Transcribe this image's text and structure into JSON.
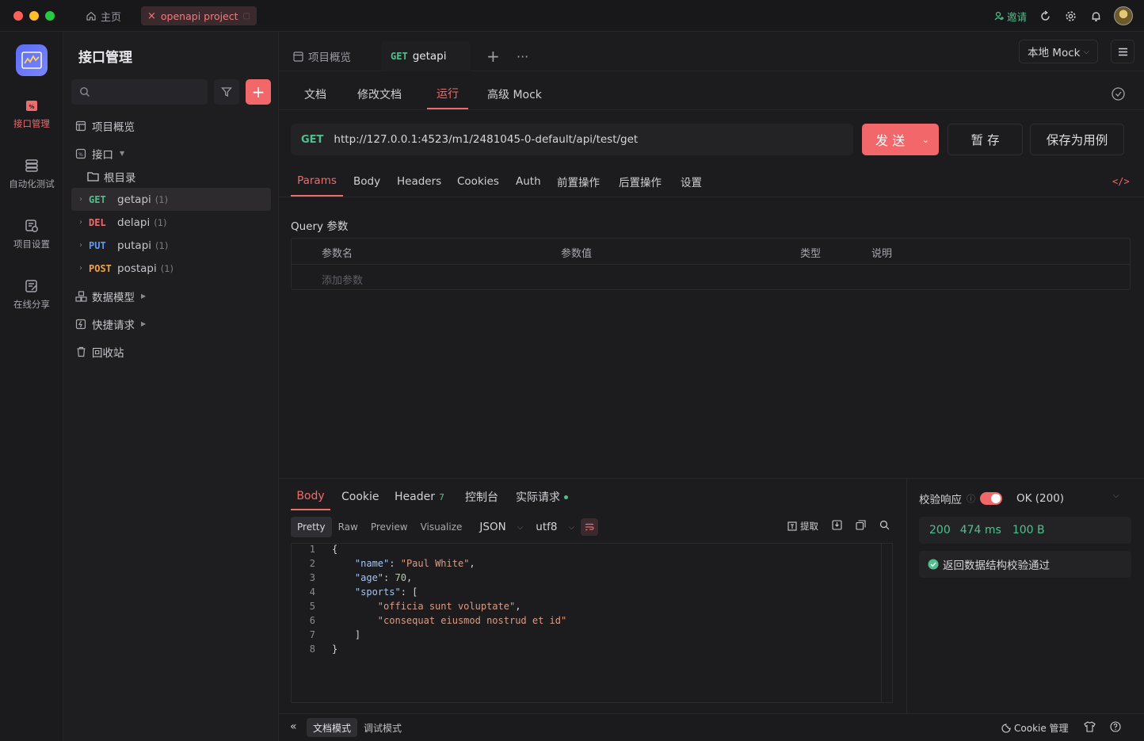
{
  "titlebar": {
    "home_label": "主页",
    "project_tab": "openapi project",
    "invite_label": "邀请"
  },
  "rail": {
    "items": [
      {
        "label": "接口管理",
        "icon": "api-icon"
      },
      {
        "label": "自动化测试",
        "icon": "database-icon"
      },
      {
        "label": "项目设置",
        "icon": "settings-icon"
      },
      {
        "label": "在线分享",
        "icon": "share-icon"
      }
    ]
  },
  "sidebar": {
    "title": "接口管理",
    "overview": "项目概览",
    "api_label": "接口",
    "root_dir": "根目录",
    "apis": [
      {
        "method": "GET",
        "name": "getapi",
        "count": "(1)",
        "color": "#4fc08d"
      },
      {
        "method": "DEL",
        "name": "delapi",
        "count": "(1)",
        "color": "#f06b6b"
      },
      {
        "method": "PUT",
        "name": "putapi",
        "count": "(1)",
        "color": "#5b9af0"
      },
      {
        "method": "POST",
        "name": "postapi",
        "count": "(1)",
        "color": "#f0a24b"
      }
    ],
    "data_model": "数据模型",
    "quick_request": "快捷请求",
    "recycle": "回收站"
  },
  "tabs": {
    "overview": "项目概览",
    "active_method": "GET",
    "active_name": "getapi",
    "mock_select": "本地 Mock"
  },
  "subtabs": [
    "文档",
    "修改文档",
    "运行",
    "高级 Mock"
  ],
  "request": {
    "method": "GET",
    "url": "http://127.0.0.1:4523/m1/2481045-0-default/api/test/get",
    "send": "发 送",
    "save_temp": "暂 存",
    "save_case": "保存为用例"
  },
  "param_tabs": [
    "Params",
    "Body",
    "Headers",
    "Cookies",
    "Auth",
    "前置操作",
    "后置操作",
    "设置"
  ],
  "query": {
    "label": "Query 参数",
    "headers": [
      "参数名",
      "参数值",
      "类型",
      "说明"
    ],
    "add_placeholder": "添加参数"
  },
  "response": {
    "tabs": [
      "Body",
      "Cookie",
      "Header",
      "控制台",
      "实际请求"
    ],
    "header_count": "7",
    "formats": [
      "Pretty",
      "Raw",
      "Preview",
      "Visualize"
    ],
    "format_type": "JSON",
    "encoding": "utf8",
    "extract": "提取",
    "code_lines": [
      "{",
      "    \"name\": \"Paul White\",",
      "    \"age\": 70,",
      "    \"sports\": [",
      "        \"officia sunt voluptate\",",
      "        \"consequat eiusmod nostrud et id\"",
      "    ]",
      "}"
    ],
    "line_numbers": [
      "1",
      "2",
      "3",
      "4",
      "5",
      "6",
      "7",
      "8"
    ]
  },
  "validation": {
    "label": "校验响应",
    "status_text": "OK (200)",
    "code": "200",
    "time": "474 ms",
    "size": "100 B",
    "result": "返回数据结构校验通过"
  },
  "footer": {
    "doc_mode": "文档模式",
    "debug_mode": "调试模式",
    "cookie_mgmt": "Cookie 管理"
  }
}
